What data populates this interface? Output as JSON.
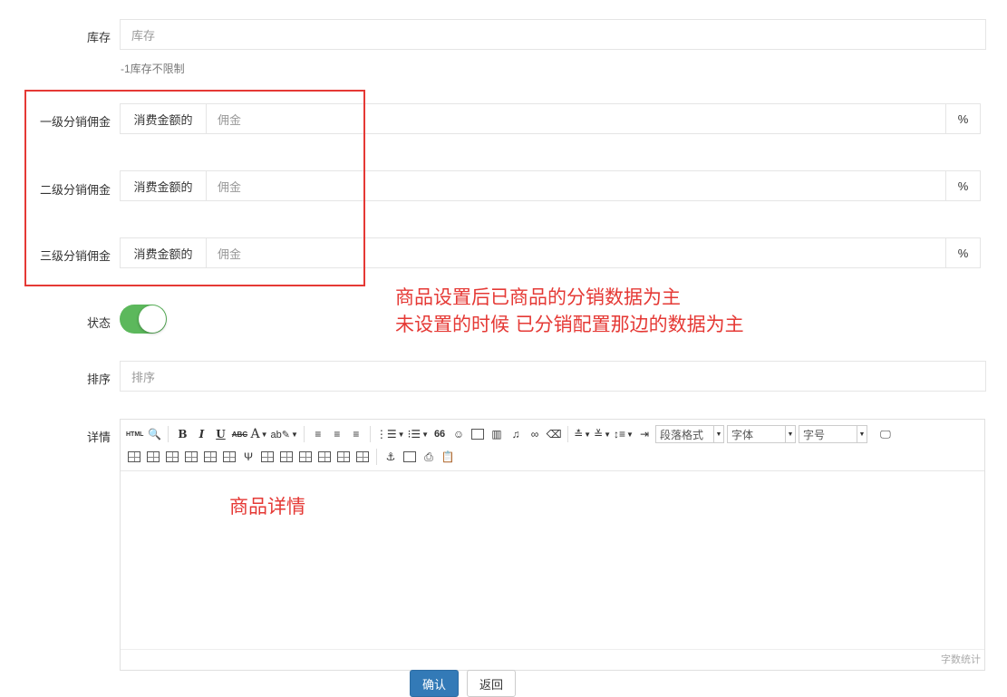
{
  "stock": {
    "label": "库存",
    "placeholder": "库存",
    "help": "-1库存不限制"
  },
  "commission": {
    "rows": [
      {
        "label": "一级分销佣金",
        "prefix": "消费金额的",
        "placeholder": "佣金",
        "suffix": "%"
      },
      {
        "label": "二级分销佣金",
        "prefix": "消费金额的",
        "placeholder": "佣金",
        "suffix": "%"
      },
      {
        "label": "三级分销佣金",
        "prefix": "消费金额的",
        "placeholder": "佣金",
        "suffix": "%"
      }
    ],
    "annotation_color": "#e53935"
  },
  "annotation": {
    "line1": "商品设置后已商品的分销数据为主",
    "line2": "未设置的时候  已分销配置那边的数据为主"
  },
  "status": {
    "label": "状态",
    "enabled": true,
    "on_color": "#5cb85c"
  },
  "sort": {
    "label": "排序",
    "placeholder": "排序"
  },
  "details": {
    "label": "详情",
    "toolbar": {
      "html": "HTML",
      "bold": "B",
      "italic": "I",
      "underline": "U",
      "strike": "ABC",
      "fontcolor": "A",
      "quote": "66",
      "paragraph_format": "段落格式",
      "font_family": "字体",
      "font_size": "字号"
    },
    "content_note": "商品详情",
    "word_count": "字数统计"
  },
  "buttons": {
    "submit": "确认",
    "back": "返回"
  },
  "colors": {
    "primary": "#337ab7",
    "border": "#e5e5e5"
  }
}
